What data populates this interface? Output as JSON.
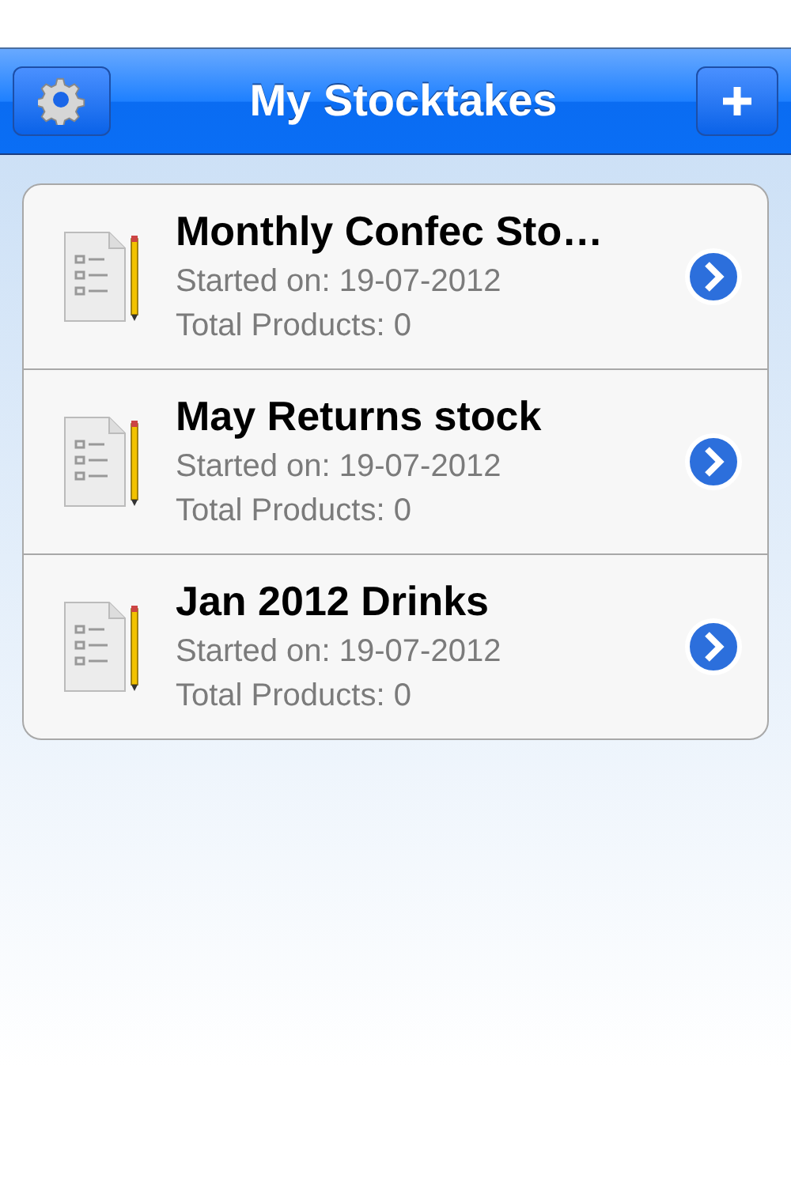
{
  "nav_bar": {
    "title": "My Stocktakes"
  },
  "stocktakes": [
    {
      "name": "Monthly Confec Sto…",
      "started": "Started on: 19-07-2012",
      "total": "Total Products: 0"
    },
    {
      "name": "May Returns stock",
      "started": "Started on: 19-07-2012",
      "total": "Total Products: 0"
    },
    {
      "name": "Jan 2012 Drinks",
      "started": "Started on: 19-07-2012",
      "total": "Total Products: 0"
    }
  ]
}
